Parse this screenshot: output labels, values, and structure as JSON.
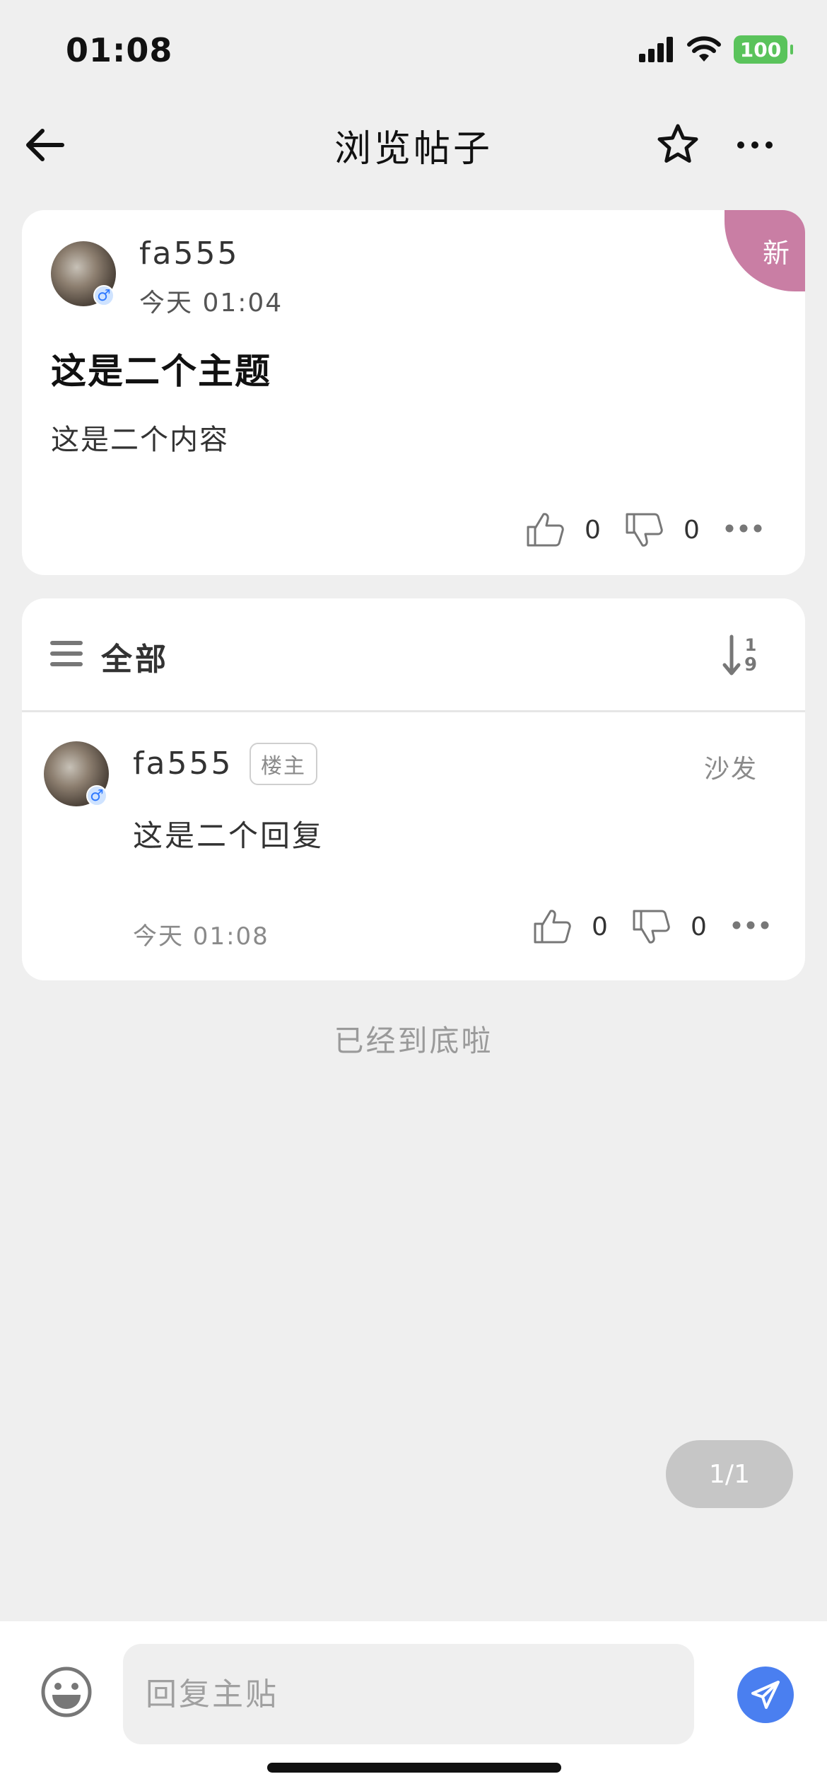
{
  "status_bar": {
    "time": "01:08",
    "battery": "100"
  },
  "nav": {
    "title": "浏览帖子"
  },
  "post": {
    "badge": "新",
    "author": "fa555",
    "gender": "♂",
    "time": "今天 01:04",
    "title": "这是二个主题",
    "content": "这是二个内容",
    "likes": "0",
    "dislikes": "0"
  },
  "replies": {
    "filter_label": "全部",
    "sort_icon": "sort-1-9-icon",
    "items": [
      {
        "author": "fa555",
        "gender": "♂",
        "tag": "楼主",
        "floor": "沙发",
        "content": "这是二个回复",
        "time": "今天 01:08",
        "likes": "0",
        "dislikes": "0"
      }
    ]
  },
  "end_text": "已经到底啦",
  "pagination": "1/1",
  "input": {
    "placeholder": "回复主贴"
  },
  "colors": {
    "accent": "#4a7ff0",
    "badge": "#c97ea4",
    "battery": "#5ac35b"
  }
}
